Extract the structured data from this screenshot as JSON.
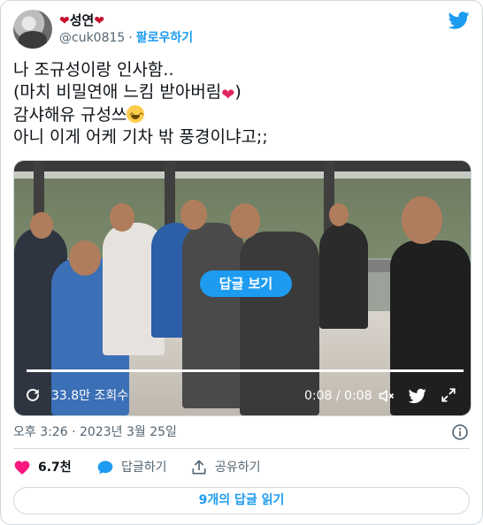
{
  "author": {
    "display_name": "성연",
    "handle": "@cuk0815",
    "follow_label": "팔로우하기"
  },
  "tweet": {
    "lines": [
      "나 조규성이랑 인사함..",
      "(마치 비밀연애 느킴 받아버림",
      ")",
      "감샤해유 규성쓰",
      "아니 이게 어케 기차 밖 풍경이냐고;;"
    ]
  },
  "video": {
    "overlay_label": "답글 보기",
    "views": "33.8만 조회수",
    "time": "0:08 / 0:08",
    "progress": 1.0
  },
  "timestamp": "오후 3:26 · 2023년 3월 25일",
  "actions": {
    "like_count": "6.7천",
    "reply_label": "답글하기",
    "share_label": "공유하기"
  },
  "read_replies_label": "9개의 답글 읽기",
  "colors": {
    "accent": "#1d9bf0",
    "like": "#f91880",
    "heart": "#c8102e"
  }
}
